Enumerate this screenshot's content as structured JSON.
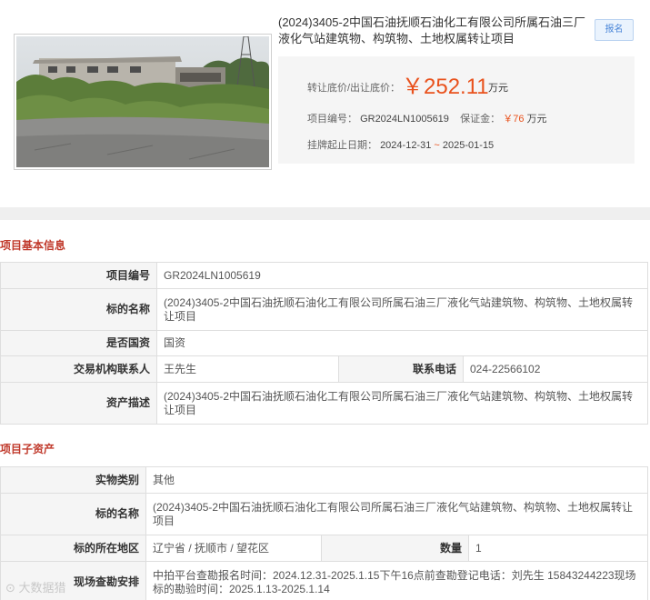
{
  "header": {
    "title": "(2024)3405-2中国石油抚顺石油化工有限公司所属石油三厂液化气站建筑物、构筑物、土地权属转让项目",
    "signup_label": "报名",
    "price_label": "转让底价/出让底价：",
    "price_value": "￥252.11",
    "price_unit": "万元",
    "project_no_label": "项目编号：",
    "project_no": "GR2024LN1005619",
    "deposit_label": "保证金：",
    "deposit_value": "￥76",
    "deposit_unit": "万元",
    "period_label": "挂牌起止日期：",
    "period_start": "2024-12-31",
    "period_sep": "~",
    "period_end": "2025-01-15"
  },
  "basic": {
    "section_title": "项目基本信息",
    "rows": {
      "no_key": "项目编号",
      "no_val": "GR2024LN1005619",
      "name_key": "标的名称",
      "name_val": "(2024)3405-2中国石油抚顺石油化工有限公司所属石油三厂液化气站建筑物、构筑物、土地权属转让项目",
      "state_key": "是否国资",
      "state_val": "国资",
      "contact_key": "交易机构联系人",
      "contact_val": "王先生",
      "phone_key": "联系电话",
      "phone_val": "024-22566102",
      "desc_key": "资产描述",
      "desc_val": "(2024)3405-2中国石油抚顺石油化工有限公司所属石油三厂液化气站建筑物、构筑物、土地权属转让项目"
    }
  },
  "sub": {
    "section_title": "项目子资产",
    "rows": {
      "type_key": "实物类别",
      "type_val": "其他",
      "name_key": "标的名称",
      "name_val": "(2024)3405-2中国石油抚顺石油化工有限公司所属石油三厂液化气站建筑物、构筑物、土地权属转让项目",
      "loc_key": "标的所在地区",
      "loc_val": "辽宁省 / 抚顺市 / 望花区",
      "qty_key": "数量",
      "qty_val": "1",
      "visit_key": "现场查勘安排",
      "visit_val": "中拍平台查勘报名时间：2024.12.31-2025.1.15下午16点前查勘登记电话：刘先生 15843244223现场标的勘验时间：2025.1.13-2025.1.14"
    }
  },
  "watermark": "大数据猎"
}
